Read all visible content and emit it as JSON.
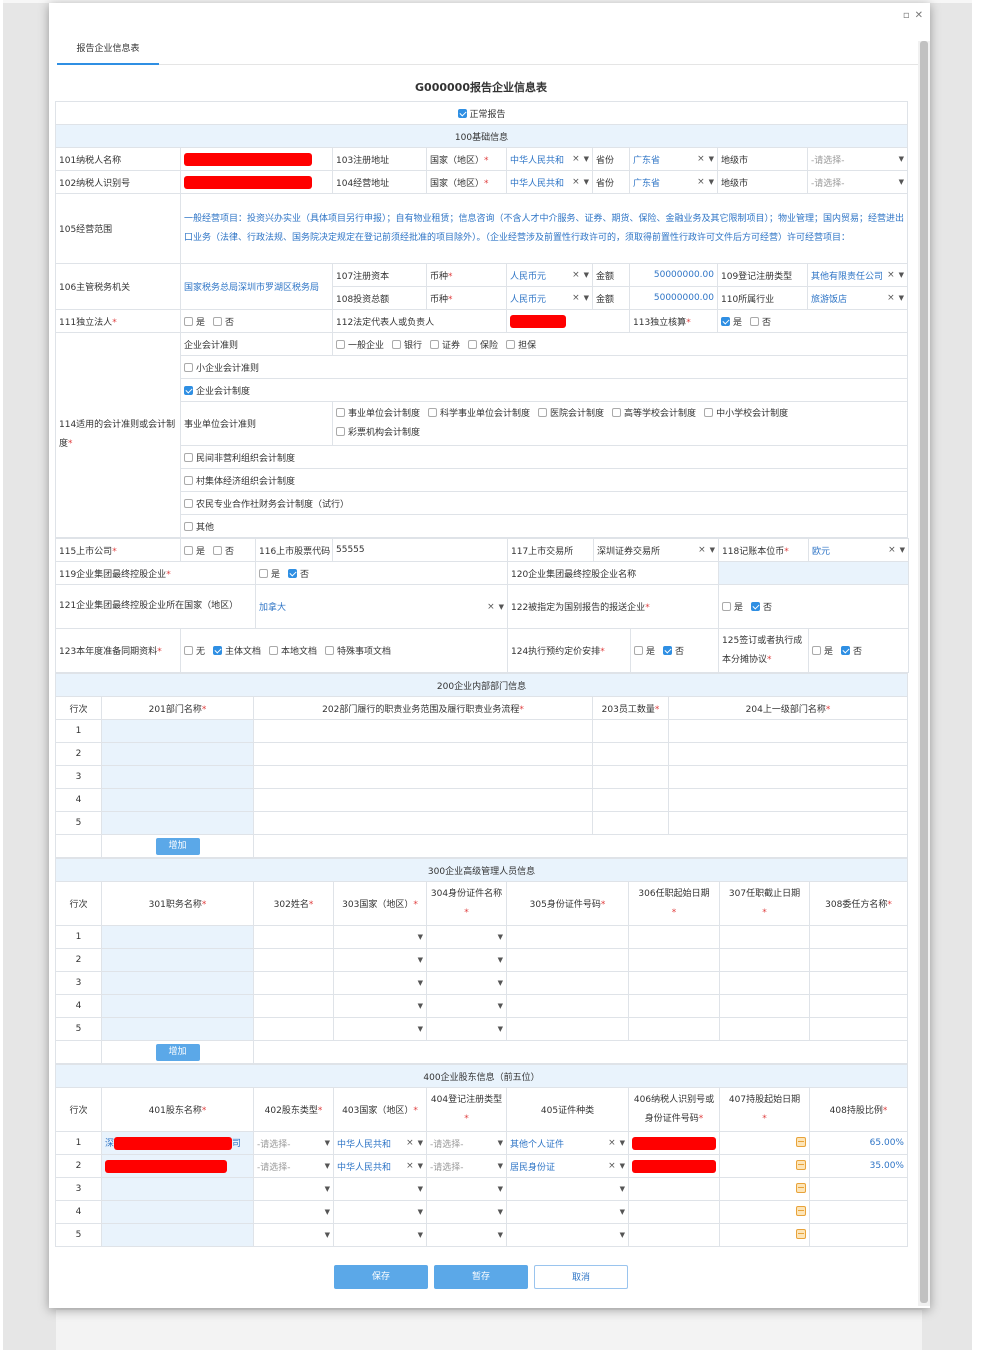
{
  "tab": "报告企业信息表",
  "form_title": "G000000报告企业信息表",
  "normal_report": "正常报告",
  "sec100": "100基础信息",
  "r101": "101纳税人名称",
  "r102": "102纳税人识别号",
  "r103": "103注册地址",
  "r104": "104经营地址",
  "country_label": "国家（地区）",
  "country_val": "中华人民共和",
  "prov_label": "省份",
  "prov_val": "广东省",
  "city_label": "地级市",
  "placeholder": "-请选择-",
  "r105": "105经营范围",
  "scope": "一般经营项目：投资兴办实业（具体项目另行申报）；自有物业租赁；信息咨询（不含人才中介服务、证券、期货、保险、金融业务及其它限制项目）；物业管理；国内贸易；经营进出口业务（法律、行政法规、国务院决定规定在登记前须经批准的项目除外）。（企业经营涉及前置性行政许可的，须取得前置性行政许可文件后方可经营）许可经营项目：",
  "r106": "106主管税务机关",
  "tax_office": "国家税务总局深圳市罗湖区税务局",
  "r107": "107注册资本",
  "r108": "108投资总额",
  "currency_label": "币种",
  "currency_val": "人民币元",
  "amount_label": "金额",
  "amount_val": "50000000.00",
  "r109": "109登记注册类型",
  "r109_val": "其他有限责任公司",
  "r110": "110所属行业",
  "r110_val": "旅游饭店",
  "r111": "111独立法人",
  "yes": "是",
  "no": "否",
  "r112": "112法定代表人或负责人",
  "r113": "113独立核算",
  "r114": "114适用的会计准则或会计制度",
  "acc_std": "企业会计准则",
  "acc_std_opts": [
    "一般企业",
    "银行",
    "证券",
    "保险",
    "担保"
  ],
  "acc_small": "小企业会计准则",
  "acc_corp": "企业会计制度",
  "acc_public": "事业单位会计准则",
  "acc_public_opts": [
    "事业单位会计制度",
    "科学事业单位会计制度",
    "医院会计制度",
    "高等学校会计制度",
    "中小学校会计制度",
    "彩票机构会计制度"
  ],
  "acc_npo": "民间非营利组织会计制度",
  "acc_village": "村集体经济组织会计制度",
  "acc_coop": "农民专业合作社财务会计制度（试行）",
  "acc_other": "其他",
  "r115": "115上市公司",
  "r116": "116上市股票代码",
  "r116_val": "55555",
  "r117": "117上市交易所",
  "r117_val": "深圳证券交易所",
  "r118": "118记账本位币",
  "r118_val": "欧元",
  "r119": "119企业集团最终控股企业",
  "r120": "120企业集团最终控股企业名称",
  "r121": "121企业集团最终控股企业所在国家（地区）",
  "r121_val": "加拿大",
  "r122": "122被指定为国别报告的报送企业",
  "r123": "123本年度准备同期资料",
  "r123_opts": [
    "无",
    "主体文档",
    "本地文档",
    "特殊事项文档"
  ],
  "r124": "124执行预约定价安排",
  "r125": "125签订或者执行成本分摊协议",
  "sec200": "200企业内部部门信息",
  "rowno": "行次",
  "h201": "201部门名称",
  "h202": "202部门履行的职责业务范围及履行职责业务流程",
  "h203": "203员工数量",
  "h204": "204上一级部门名称",
  "rows": [
    "1",
    "2",
    "3",
    "4",
    "5"
  ],
  "add": "增加",
  "sec300": "300企业高级管理人员信息",
  "h301": "301职务名称",
  "h302": "302姓名",
  "h303": "303国家（地区）",
  "h304": "304身份证件名称",
  "h305": "305身份证件号码",
  "h306": "306任职起始日期",
  "h307": "307任职截止日期",
  "h308": "308委任方名称",
  "sec400": "400企业股东信息（前五位）",
  "h401": "401股东名称",
  "h402": "402股东类型",
  "h403": "403国家（地区）",
  "h404": "404登记注册类型",
  "h405": "405证件种类",
  "h406": "406纳税人识别号或身份证件号码",
  "h407": "407持股起始日期",
  "h408": "408持股比例",
  "sh1_name_a": "深",
  "sh1_name_b": "司",
  "sh1_doc": "其他个人证件",
  "sh1_ratio": "65.00%",
  "sh2_doc": "居民身份证",
  "sh2_ratio": "35.00%",
  "btn_save": "保存",
  "btn_temp": "暂存",
  "btn_cancel": "取消",
  "colors": {
    "accent": "#2f8fe3",
    "button": "#5ba8e8",
    "redact": "#ff0000"
  }
}
